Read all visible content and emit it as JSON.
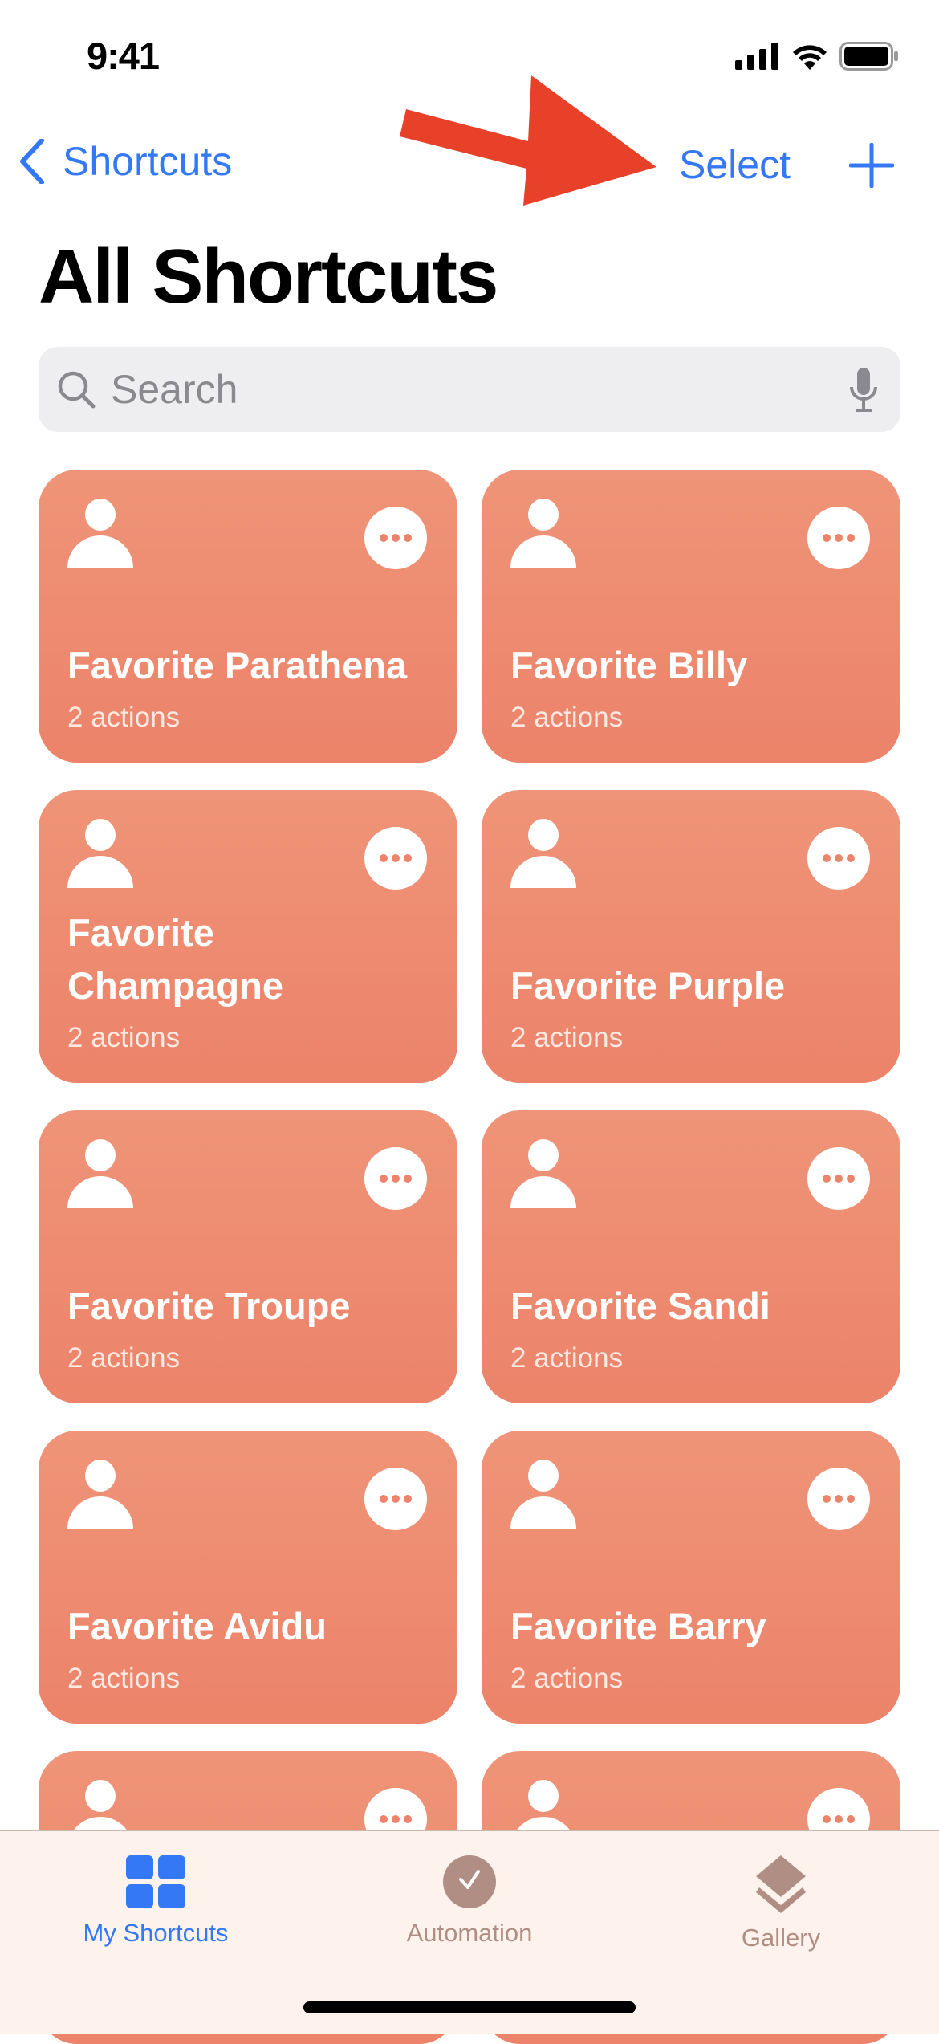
{
  "status_bar": {
    "time": "9:41",
    "icons": [
      "cellular-signal-icon",
      "wifi-icon",
      "battery-icon"
    ]
  },
  "nav": {
    "back_label": "Shortcuts",
    "select_label": "Select",
    "add_icon": "plus-icon"
  },
  "header": {
    "title": "All Shortcuts"
  },
  "search": {
    "placeholder": "Search"
  },
  "annotation": {
    "type": "red-arrow",
    "points_to": "Select",
    "color": "#e8412a"
  },
  "colors": {
    "accent": "#3478f6",
    "card": "#ec836a",
    "tab_inactive": "#b08e84",
    "tabbar_bg": "#fdf2ec"
  },
  "shortcuts": [
    {
      "title": "Favorite Parathena",
      "subtitle": "2 actions"
    },
    {
      "title": "Favorite Billy",
      "subtitle": "2 actions"
    },
    {
      "title": "Favorite Champagne",
      "subtitle": "2 actions"
    },
    {
      "title": "Favorite Purple",
      "subtitle": "2 actions"
    },
    {
      "title": "Favorite Troupe",
      "subtitle": "2 actions"
    },
    {
      "title": "Favorite Sandi",
      "subtitle": "2 actions"
    },
    {
      "title": "Favorite Avidu",
      "subtitle": "2 actions"
    },
    {
      "title": "Favorite Barry",
      "subtitle": "2 actions"
    },
    {
      "title": "",
      "subtitle": ""
    },
    {
      "title": "",
      "subtitle": ""
    }
  ],
  "tabs": [
    {
      "label": "My Shortcuts",
      "icon": "grid-icon",
      "active": true
    },
    {
      "label": "Automation",
      "icon": "clock-check-icon",
      "active": false
    },
    {
      "label": "Gallery",
      "icon": "layers-icon",
      "active": false
    }
  ]
}
